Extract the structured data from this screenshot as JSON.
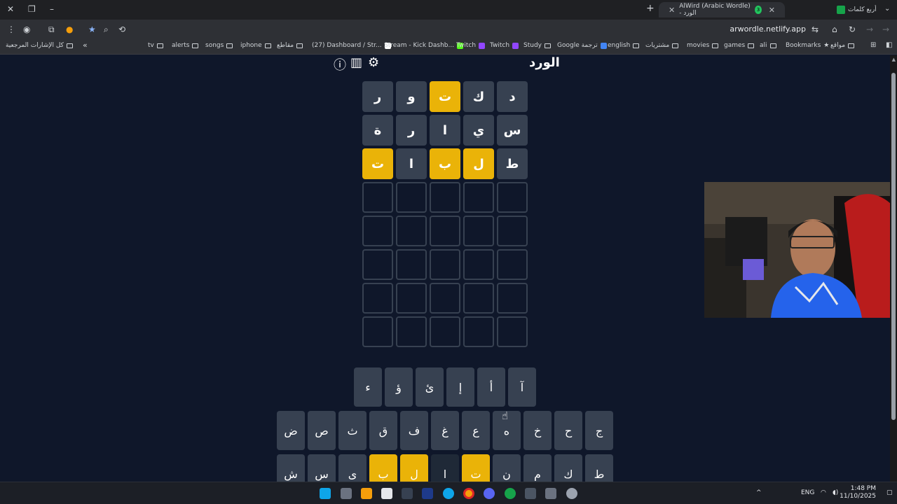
{
  "browser": {
    "tabs": [
      {
        "title": "أربع كلمات",
        "active": false
      },
      {
        "title": "AlWird (Arabic Wordle) - الورد",
        "badge": "3",
        "active": true
      }
    ],
    "url": "arwordle.netlify.app",
    "bookmarks": [
      "مواقع",
      "Bookmarks",
      "ali",
      "games",
      "movies",
      "مشتريات",
      "english",
      "Google ترجمة",
      "Study",
      "Twitch",
      "Twitch",
      "Stream - Kick Dashb...",
      "(27) Dashboard / Str...",
      "مقاطع",
      "iphone",
      "songs",
      "alerts",
      "tv",
      "كل الإشارات المرجعية"
    ]
  },
  "game": {
    "title": "الورد",
    "rows": [
      [
        {
          "l": "د",
          "s": "absent"
        },
        {
          "l": "ك",
          "s": "absent"
        },
        {
          "l": "ت",
          "s": "present"
        },
        {
          "l": "و",
          "s": "absent"
        },
        {
          "l": "ر",
          "s": "absent"
        }
      ],
      [
        {
          "l": "س",
          "s": "absent"
        },
        {
          "l": "ي",
          "s": "absent"
        },
        {
          "l": "ا",
          "s": "absent"
        },
        {
          "l": "ر",
          "s": "absent"
        },
        {
          "l": "ة",
          "s": "absent"
        }
      ],
      [
        {
          "l": "ط",
          "s": "absent"
        },
        {
          "l": "ل",
          "s": "present"
        },
        {
          "l": "ب",
          "s": "present"
        },
        {
          "l": "ا",
          "s": "absent"
        },
        {
          "l": "ت",
          "s": "present"
        }
      ],
      [
        {
          "l": "",
          "s": "empty"
        },
        {
          "l": "",
          "s": "empty"
        },
        {
          "l": "",
          "s": "empty"
        },
        {
          "l": "",
          "s": "empty"
        },
        {
          "l": "",
          "s": "empty"
        }
      ],
      [
        {
          "l": "",
          "s": "empty"
        },
        {
          "l": "",
          "s": "empty"
        },
        {
          "l": "",
          "s": "empty"
        },
        {
          "l": "",
          "s": "empty"
        },
        {
          "l": "",
          "s": "empty"
        }
      ],
      [
        {
          "l": "",
          "s": "empty"
        },
        {
          "l": "",
          "s": "empty"
        },
        {
          "l": "",
          "s": "empty"
        },
        {
          "l": "",
          "s": "empty"
        },
        {
          "l": "",
          "s": "empty"
        }
      ],
      [
        {
          "l": "",
          "s": "empty"
        },
        {
          "l": "",
          "s": "empty"
        },
        {
          "l": "",
          "s": "empty"
        },
        {
          "l": "",
          "s": "empty"
        },
        {
          "l": "",
          "s": "empty"
        }
      ],
      [
        {
          "l": "",
          "s": "empty"
        },
        {
          "l": "",
          "s": "empty"
        },
        {
          "l": "",
          "s": "empty"
        },
        {
          "l": "",
          "s": "empty"
        },
        {
          "l": "",
          "s": "empty"
        }
      ]
    ],
    "keyboard": {
      "row1": [
        "آ",
        "أ",
        "إ",
        "ئ",
        "ؤ",
        "ء"
      ],
      "row2": [
        "ج",
        "ح",
        "خ",
        "ه",
        "ع",
        "غ",
        "ف",
        "ق",
        "ث",
        "ص",
        "ض"
      ],
      "row3": [
        {
          "l": "ط",
          "s": "normal"
        },
        {
          "l": "ك",
          "s": "normal"
        },
        {
          "l": "م",
          "s": "normal"
        },
        {
          "l": "ن",
          "s": "normal"
        },
        {
          "l": "ت",
          "s": "present"
        },
        {
          "l": "ا",
          "s": "absent"
        },
        {
          "l": "ل",
          "s": "present"
        },
        {
          "l": "ب",
          "s": "present"
        },
        {
          "l": "ى",
          "s": "normal"
        },
        {
          "l": "س",
          "s": "normal"
        },
        {
          "l": "ش",
          "s": "normal"
        }
      ]
    }
  },
  "taskbar": {
    "lang": "ENG",
    "time": "1:48 PM",
    "date": "11/10/2025"
  },
  "colors": {
    "present": "#eab308",
    "absent": "#374151",
    "background": "#0f172a"
  }
}
